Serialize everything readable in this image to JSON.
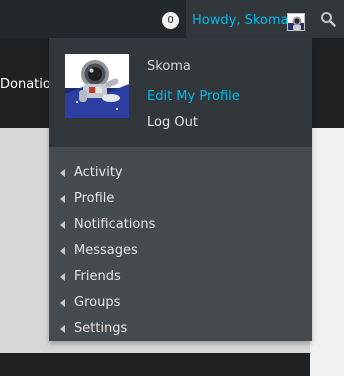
{
  "admin_bar": {
    "notification_count": "0",
    "howdy_text": "Howdy, Skoma",
    "search_icon": "search-icon"
  },
  "site": {
    "nav_text": "Donation"
  },
  "dropdown": {
    "display_name": "Skoma",
    "edit_profile": "Edit My Profile",
    "log_out": "Log Out",
    "menu": [
      {
        "label": "Activity"
      },
      {
        "label": "Profile"
      },
      {
        "label": "Notifications"
      },
      {
        "label": "Messages"
      },
      {
        "label": "Friends"
      },
      {
        "label": "Groups"
      },
      {
        "label": "Settings"
      }
    ]
  },
  "colors": {
    "admin_bar_bg": "#23282d",
    "submenu_bg": "#464b50",
    "link_accent": "#00b9eb"
  }
}
